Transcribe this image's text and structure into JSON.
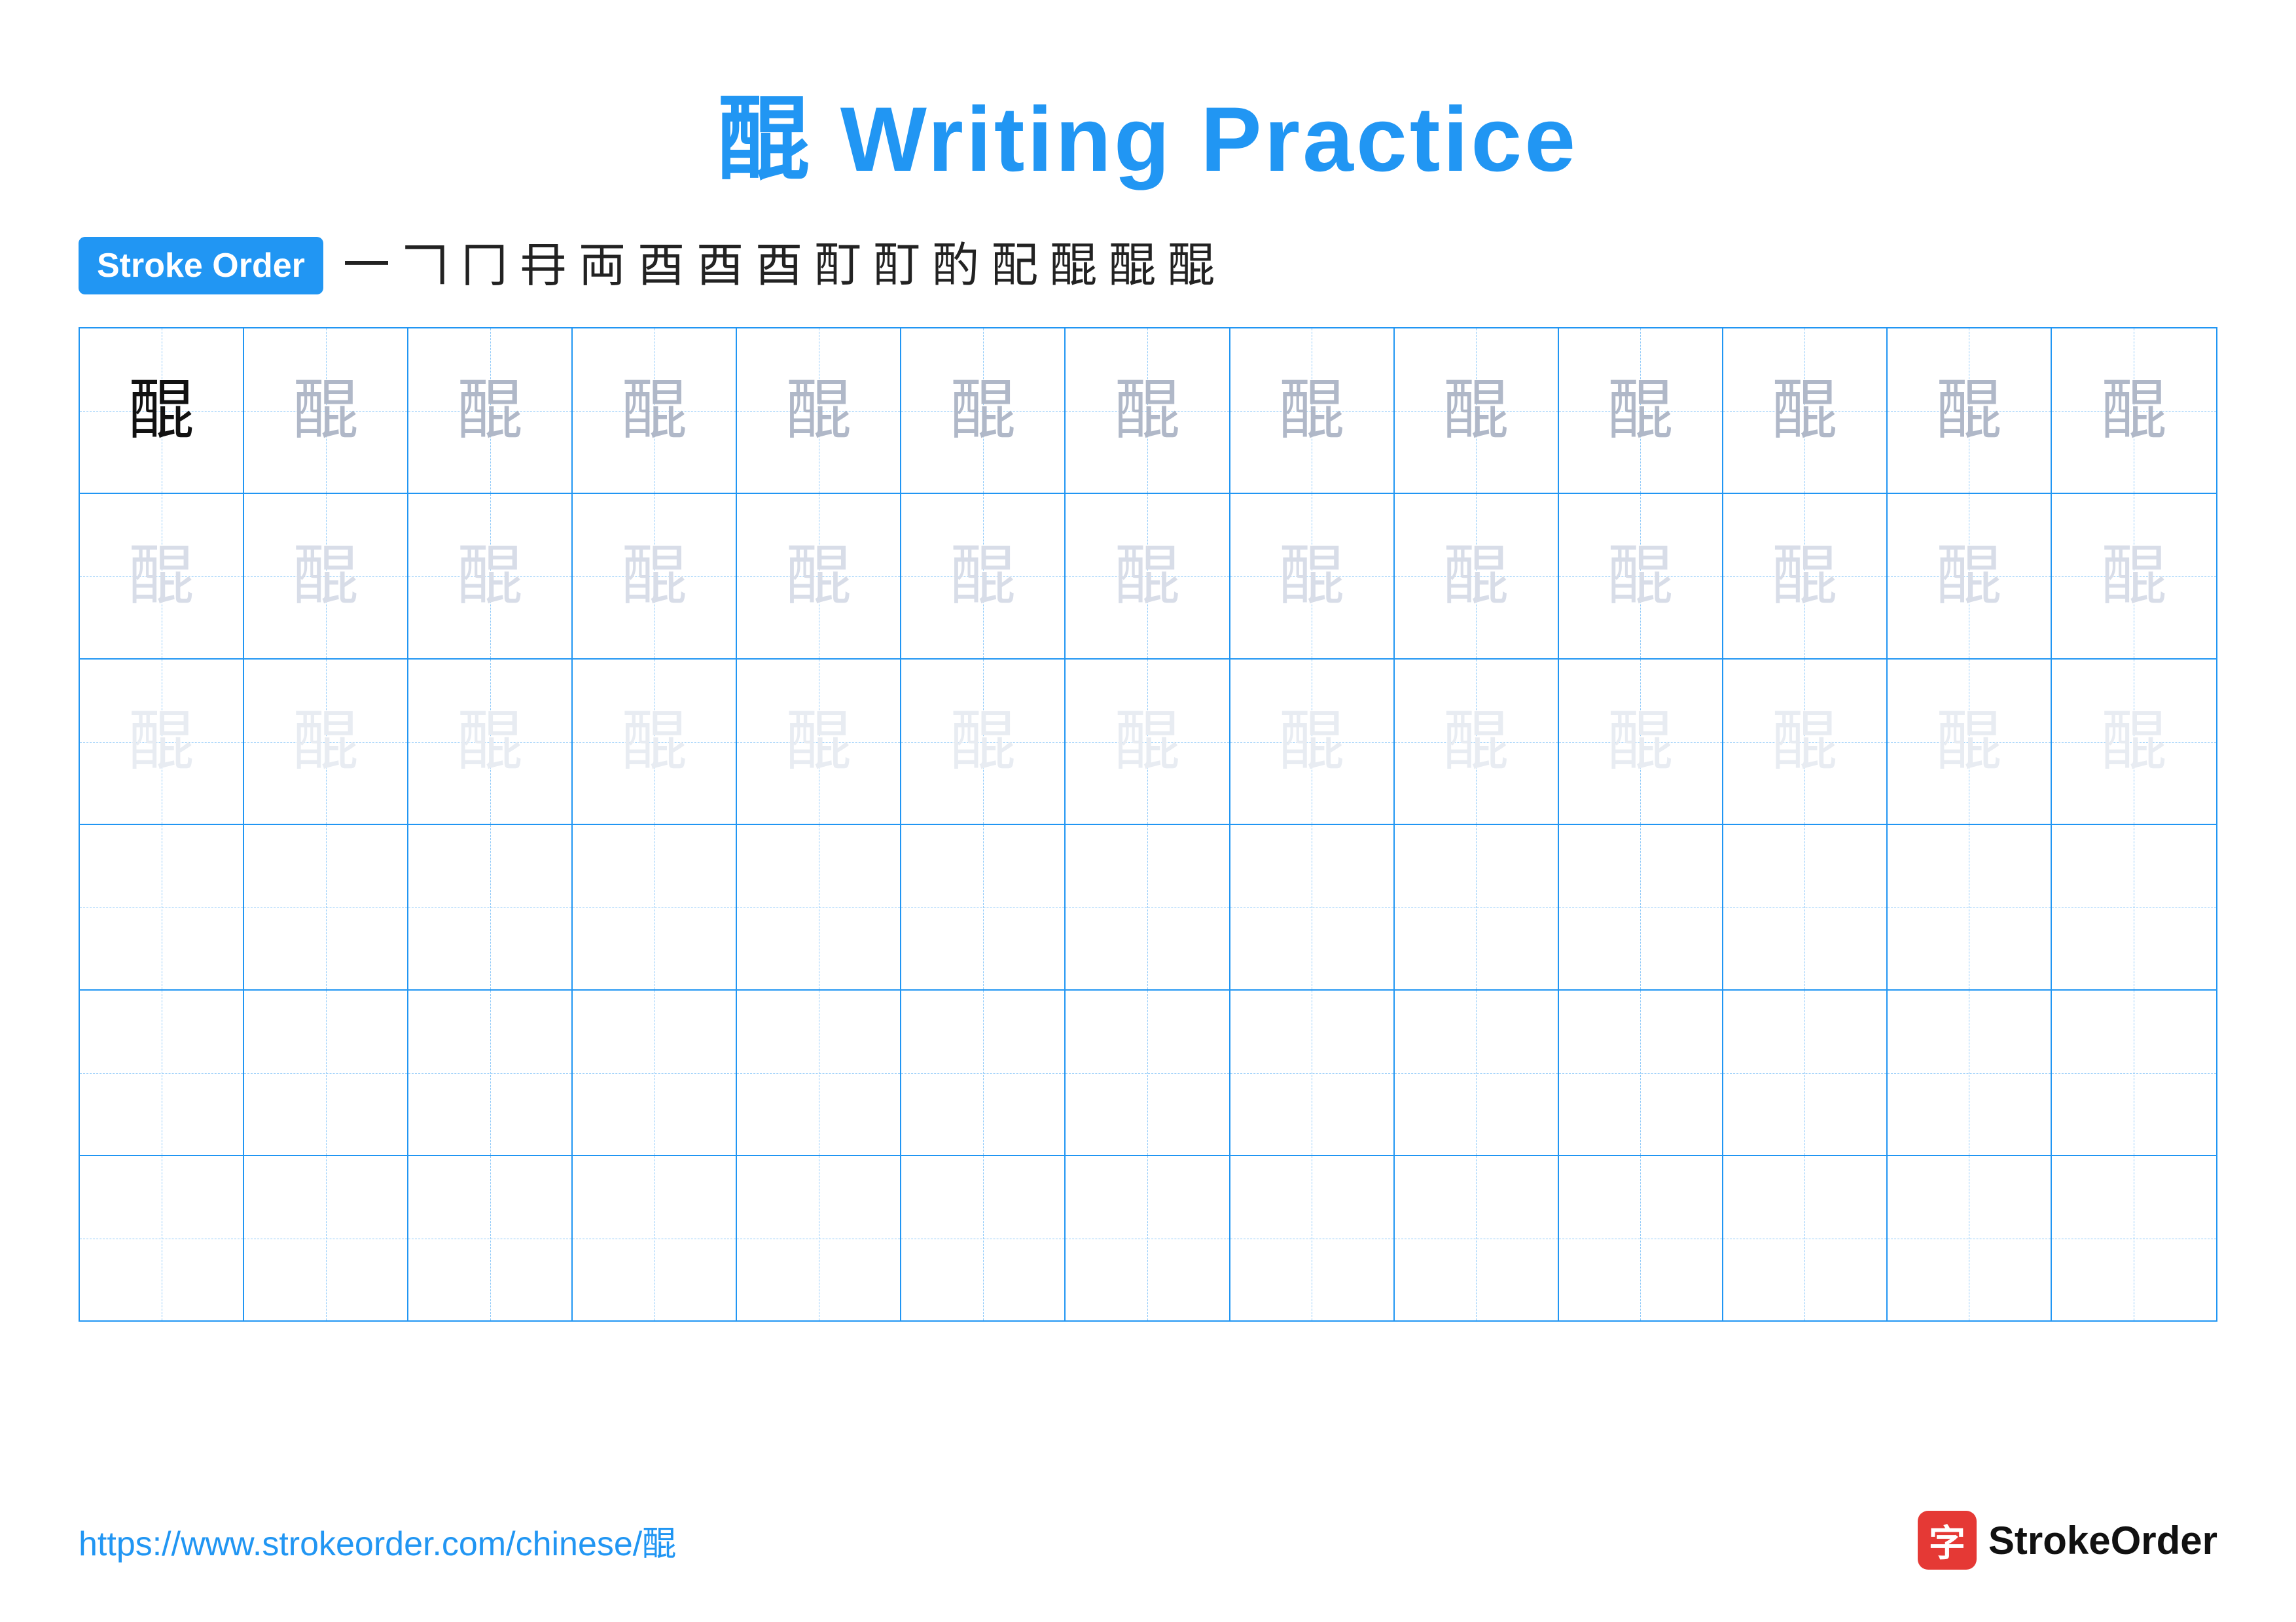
{
  "title": "醌 Writing Practice",
  "strokeOrder": {
    "label": "Stroke Order",
    "steps": [
      "一",
      "𠃍",
      "冂",
      "冄",
      "両",
      "酉",
      "酉",
      "酉",
      "酊",
      "酊",
      "酌",
      "配",
      "醌",
      "醌",
      "醌"
    ]
  },
  "character": "醌",
  "rows": [
    {
      "cells": [
        {
          "char": "醌",
          "style": "dark"
        },
        {
          "char": "醌",
          "style": "medium"
        },
        {
          "char": "醌",
          "style": "medium"
        },
        {
          "char": "醌",
          "style": "medium"
        },
        {
          "char": "醌",
          "style": "medium"
        },
        {
          "char": "醌",
          "style": "medium"
        },
        {
          "char": "醌",
          "style": "medium"
        },
        {
          "char": "醌",
          "style": "medium"
        },
        {
          "char": "醌",
          "style": "medium"
        },
        {
          "char": "醌",
          "style": "medium"
        },
        {
          "char": "醌",
          "style": "medium"
        },
        {
          "char": "醌",
          "style": "medium"
        },
        {
          "char": "醌",
          "style": "medium"
        }
      ]
    },
    {
      "cells": [
        {
          "char": "醌",
          "style": "light"
        },
        {
          "char": "醌",
          "style": "light"
        },
        {
          "char": "醌",
          "style": "light"
        },
        {
          "char": "醌",
          "style": "light"
        },
        {
          "char": "醌",
          "style": "light"
        },
        {
          "char": "醌",
          "style": "light"
        },
        {
          "char": "醌",
          "style": "light"
        },
        {
          "char": "醌",
          "style": "light"
        },
        {
          "char": "醌",
          "style": "light"
        },
        {
          "char": "醌",
          "style": "light"
        },
        {
          "char": "醌",
          "style": "light"
        },
        {
          "char": "醌",
          "style": "light"
        },
        {
          "char": "醌",
          "style": "light"
        }
      ]
    },
    {
      "cells": [
        {
          "char": "醌",
          "style": "very-light"
        },
        {
          "char": "醌",
          "style": "very-light"
        },
        {
          "char": "醌",
          "style": "very-light"
        },
        {
          "char": "醌",
          "style": "very-light"
        },
        {
          "char": "醌",
          "style": "very-light"
        },
        {
          "char": "醌",
          "style": "very-light"
        },
        {
          "char": "醌",
          "style": "very-light"
        },
        {
          "char": "醌",
          "style": "very-light"
        },
        {
          "char": "醌",
          "style": "very-light"
        },
        {
          "char": "醌",
          "style": "very-light"
        },
        {
          "char": "醌",
          "style": "very-light"
        },
        {
          "char": "醌",
          "style": "very-light"
        },
        {
          "char": "醌",
          "style": "very-light"
        }
      ]
    },
    {
      "cells": [
        {
          "char": "",
          "style": "empty"
        },
        {
          "char": "",
          "style": "empty"
        },
        {
          "char": "",
          "style": "empty"
        },
        {
          "char": "",
          "style": "empty"
        },
        {
          "char": "",
          "style": "empty"
        },
        {
          "char": "",
          "style": "empty"
        },
        {
          "char": "",
          "style": "empty"
        },
        {
          "char": "",
          "style": "empty"
        },
        {
          "char": "",
          "style": "empty"
        },
        {
          "char": "",
          "style": "empty"
        },
        {
          "char": "",
          "style": "empty"
        },
        {
          "char": "",
          "style": "empty"
        },
        {
          "char": "",
          "style": "empty"
        }
      ]
    },
    {
      "cells": [
        {
          "char": "",
          "style": "empty"
        },
        {
          "char": "",
          "style": "empty"
        },
        {
          "char": "",
          "style": "empty"
        },
        {
          "char": "",
          "style": "empty"
        },
        {
          "char": "",
          "style": "empty"
        },
        {
          "char": "",
          "style": "empty"
        },
        {
          "char": "",
          "style": "empty"
        },
        {
          "char": "",
          "style": "empty"
        },
        {
          "char": "",
          "style": "empty"
        },
        {
          "char": "",
          "style": "empty"
        },
        {
          "char": "",
          "style": "empty"
        },
        {
          "char": "",
          "style": "empty"
        },
        {
          "char": "",
          "style": "empty"
        }
      ]
    },
    {
      "cells": [
        {
          "char": "",
          "style": "empty"
        },
        {
          "char": "",
          "style": "empty"
        },
        {
          "char": "",
          "style": "empty"
        },
        {
          "char": "",
          "style": "empty"
        },
        {
          "char": "",
          "style": "empty"
        },
        {
          "char": "",
          "style": "empty"
        },
        {
          "char": "",
          "style": "empty"
        },
        {
          "char": "",
          "style": "empty"
        },
        {
          "char": "",
          "style": "empty"
        },
        {
          "char": "",
          "style": "empty"
        },
        {
          "char": "",
          "style": "empty"
        },
        {
          "char": "",
          "style": "empty"
        },
        {
          "char": "",
          "style": "empty"
        }
      ]
    }
  ],
  "footer": {
    "url": "https://www.strokeorder.com/chinese/醌",
    "logoChar": "字",
    "logoText": "StrokeOrder"
  }
}
